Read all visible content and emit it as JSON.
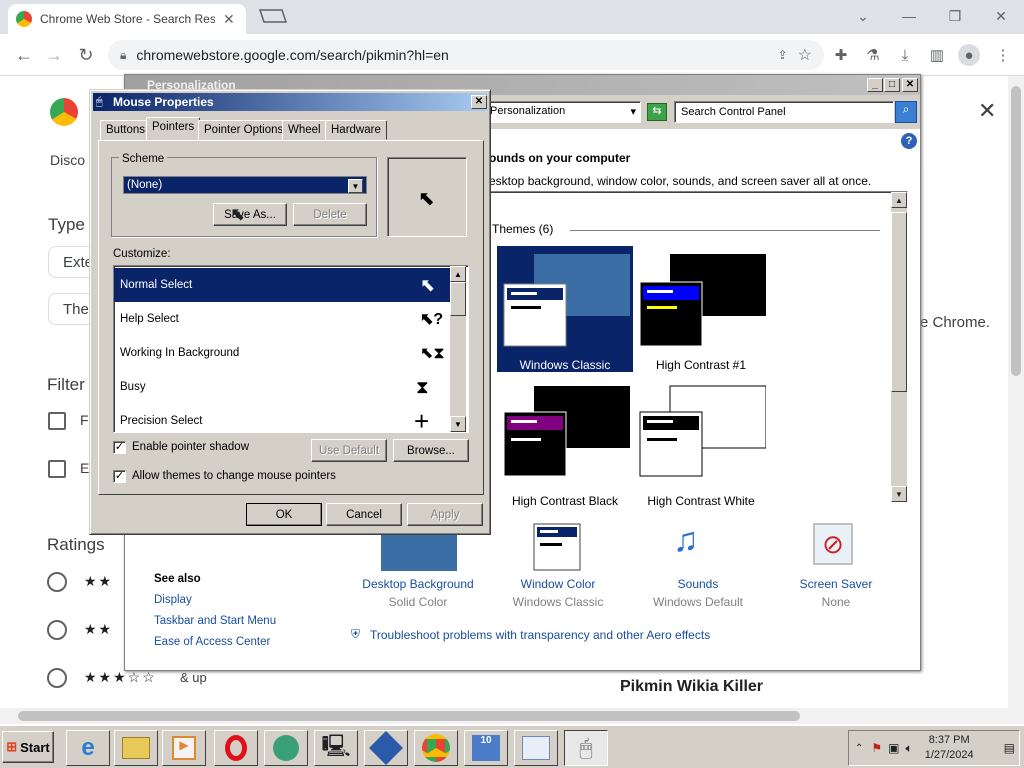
{
  "browser": {
    "tab_title": "Chrome Web Store - Search Res",
    "url": "chromewebstore.google.com/search/pikmin?hl=en"
  },
  "page": {
    "discover_label": "Disco",
    "type_heading": "Type",
    "type_pills": [
      "Exte",
      "The"
    ],
    "filter_heading": "Filter",
    "filter_items": [
      "F",
      "E"
    ],
    "ratings_heading": "Ratings",
    "rating_suffix": "& up",
    "right_text": "e Chrome.",
    "result_title": "Pikmin Wikia Killer"
  },
  "personalization": {
    "title": "Personalization",
    "address": "Personalization",
    "search_placeholder": "Search Control Panel",
    "heading": "ounds on your computer",
    "subheading": "esktop background, window color, sounds, and screen saver all at once.",
    "themes_label": "Themes (6)",
    "themes": [
      {
        "name": "Windows Classic",
        "selected": true
      },
      {
        "name": "High Contrast #1",
        "selected": false
      },
      {
        "name": "High Contrast Black",
        "selected": false
      },
      {
        "name": "High Contrast White",
        "selected": false
      }
    ],
    "bottom_items": [
      {
        "label": "Desktop Background",
        "sub": "Solid Color"
      },
      {
        "label": "Window Color",
        "sub": "Windows Classic"
      },
      {
        "label": "Sounds",
        "sub": "Windows Default"
      },
      {
        "label": "Screen Saver",
        "sub": "None"
      }
    ],
    "see_also": "See also",
    "see_also_links": [
      "Display",
      "Taskbar and Start Menu",
      "Ease of Access Center"
    ],
    "troubleshoot": "Troubleshoot problems with transparency and other Aero effects"
  },
  "mouse": {
    "title": "Mouse Properties",
    "tabs": [
      "Buttons",
      "Pointers",
      "Pointer Options",
      "Wheel",
      "Hardware"
    ],
    "scheme_label": "Scheme",
    "scheme_value": "(None)",
    "save_as": "Save As...",
    "delete": "Delete",
    "customize_label": "Customize:",
    "pointers": [
      {
        "name": "Normal Select",
        "glyph": "➤"
      },
      {
        "name": "Help Select",
        "glyph": "?"
      },
      {
        "name": "Working In Background",
        "glyph": "⧗"
      },
      {
        "name": "Busy",
        "glyph": "⧗"
      },
      {
        "name": "Precision Select",
        "glyph": "+"
      }
    ],
    "enable_shadow": "Enable pointer shadow",
    "allow_themes": "Allow themes to change mouse pointers",
    "use_default": "Use Default",
    "browse": "Browse...",
    "ok": "OK",
    "cancel": "Cancel",
    "apply": "Apply"
  },
  "taskbar": {
    "start": "Start",
    "time": "8:37 PM",
    "date": "1/27/2024"
  }
}
